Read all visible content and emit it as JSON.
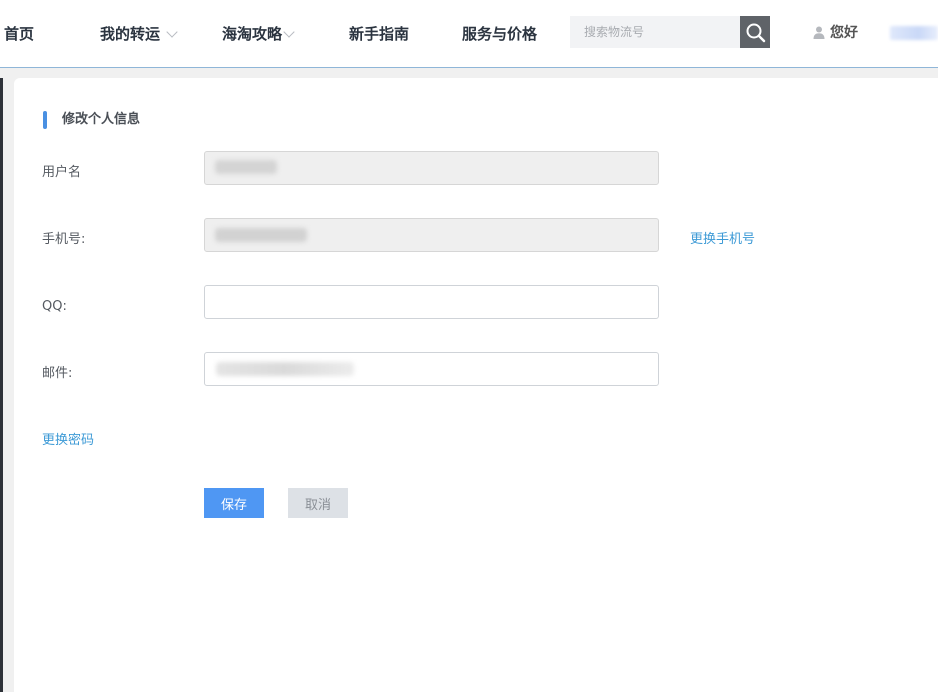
{
  "nav": {
    "items": [
      {
        "label": "首页",
        "has_dropdown": false
      },
      {
        "label": "我的转运",
        "has_dropdown": true
      },
      {
        "label": "海淘攻略",
        "has_dropdown": true
      },
      {
        "label": "新手指南",
        "has_dropdown": false
      },
      {
        "label": "服务与价格",
        "has_dropdown": false
      }
    ],
    "search": {
      "placeholder": "搜索物流号",
      "icon": "search-icon"
    },
    "user": {
      "icon": "user-icon",
      "greeting": "您好"
    }
  },
  "form": {
    "title": "修改个人信息",
    "fields": {
      "username": {
        "label": "用户名"
      },
      "phone": {
        "label": "手机号:",
        "action": "更换手机号"
      },
      "qq": {
        "label": "QQ:",
        "value": ""
      },
      "email": {
        "label": "邮件:"
      }
    },
    "change_password": "更换密码",
    "buttons": {
      "save": "保存",
      "cancel": "取消"
    }
  },
  "colors": {
    "accent": "#4f97f3",
    "link": "#3d9ad6",
    "section_marker": "#4a90e2",
    "cancel_bg": "#dde1e6"
  }
}
